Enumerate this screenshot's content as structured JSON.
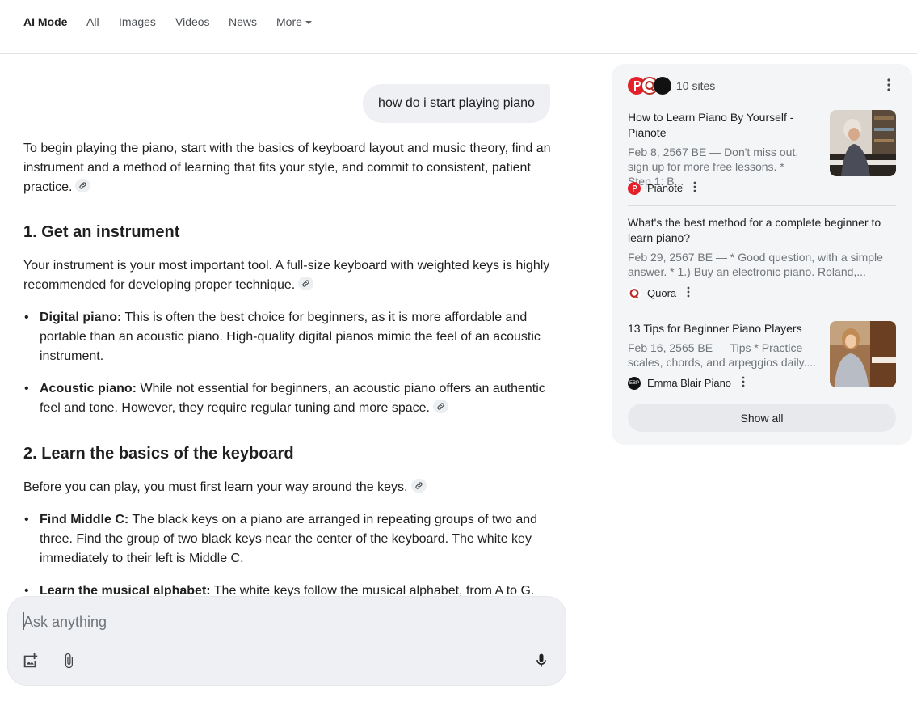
{
  "nav": {
    "tabs": [
      {
        "label": "AI Mode",
        "active": true
      },
      {
        "label": "All"
      },
      {
        "label": "Images"
      },
      {
        "label": "Videos"
      },
      {
        "label": "News"
      },
      {
        "label": "More"
      }
    ]
  },
  "conversation": {
    "user_query": "how do i start playing piano",
    "intro": "To begin playing the piano, start with the basics of keyboard layout and music theory, find an instrument and a method of learning that fits your style, and commit to consistent, patient practice.",
    "sections": [
      {
        "heading": "1. Get an instrument",
        "text": "Your instrument is your most important tool. A full-size keyboard with weighted keys is highly recommended for developing proper technique.",
        "bullets": [
          {
            "bold": "Digital piano:",
            "text": " This is often the best choice for beginners, as it is more affordable and portable than an acoustic piano. High-quality digital pianos mimic the feel of an acoustic instrument."
          },
          {
            "bold": "Acoustic piano:",
            "text": " While not essential for beginners, an acoustic piano offers an authentic feel and tone. However, they require regular tuning and more space."
          }
        ]
      },
      {
        "heading": "2. Learn the basics of the keyboard",
        "text": "Before you can play, you must first learn your way around the keys.",
        "bullets": [
          {
            "bold": "Find Middle C:",
            "text": " The black keys on a piano are arranged in repeating groups of two and three. Find the group of two black keys near the center of the keyboard. The white key immediately to their left is Middle C."
          },
          {
            "bold": "Learn the musical alphabet:",
            "text": " The white keys follow the musical alphabet, from A to G."
          }
        ]
      }
    ]
  },
  "ask": {
    "placeholder": "Ask anything"
  },
  "sources": {
    "count_label": "10 sites",
    "show_all_label": "Show all",
    "cards": [
      {
        "title": "How to Learn Piano By Yourself - Pianote",
        "snippet": "Feb 8, 2567 BE — Don't miss out, sign up for more free lessons. * Step 1: B...",
        "source": "Pianote",
        "logo_color": "#e4202b"
      },
      {
        "title": "What's the best method for a complete beginner to learn piano?",
        "snippet": "Feb 29, 2567 BE — * Good question, with a simple answer. * 1.) Buy an electronic piano. Roland,...",
        "source": "Quora",
        "logo_color": "#b92b27"
      },
      {
        "title": "13 Tips for Beginner Piano Players",
        "snippet": "Feb 16, 2565 BE — Tips * Practice scales, chords, and arpeggios daily....",
        "source": "Emma Blair Piano",
        "logo_color": "#111111",
        "logo_text": "EBP"
      }
    ]
  },
  "colors": {
    "accent": "#1a73e8",
    "panel_bg": "#f4f5f7",
    "bubble_bg": "#eef0f3"
  }
}
